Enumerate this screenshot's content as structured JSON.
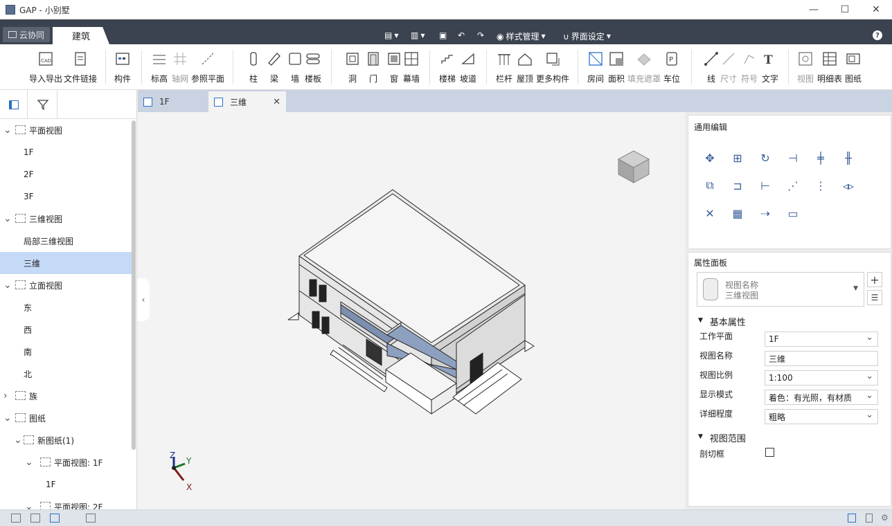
{
  "window": {
    "title": "GAP - 小别墅"
  },
  "tabs": {
    "cloud": "云协同",
    "architecture": "建筑"
  },
  "quick_access": {
    "style_manage": "样式管理",
    "ui_settings": "界面设定"
  },
  "ribbon": {
    "import_export": "导入导出",
    "file_link": "文件链接",
    "component": "构件",
    "elevation": "标高",
    "axis_grid": "轴网",
    "ref_plane": "参照平面",
    "column": "柱",
    "beam": "梁",
    "wall": "墙",
    "floor": "楼板",
    "opening": "洞",
    "door": "门",
    "window": "窗",
    "curtain_wall": "幕墙",
    "stair": "楼梯",
    "ramp": "坡道",
    "railing": "栏杆",
    "roof": "屋顶",
    "more": "更多构件",
    "room": "房间",
    "area": "面积",
    "fill_mask": "填充遮罩",
    "parking": "车位",
    "line": "线",
    "dimension": "尺寸",
    "symbol": "符号",
    "text": "文字",
    "view": "视图",
    "schedule": "明细表",
    "sheet": "图纸",
    "cad_badge": "CAD"
  },
  "tree": [
    {
      "label": "平面视图",
      "level": 0,
      "expanded": true
    },
    {
      "label": "1F",
      "level": 1
    },
    {
      "label": "2F",
      "level": 1
    },
    {
      "label": "3F",
      "level": 1
    },
    {
      "label": "三维视图",
      "level": 0,
      "expanded": true
    },
    {
      "label": "局部三维视图",
      "level": 1
    },
    {
      "label": "三维",
      "level": 1,
      "selected": true
    },
    {
      "label": "立面视图",
      "level": 0,
      "expanded": true
    },
    {
      "label": "东",
      "level": 1
    },
    {
      "label": "西",
      "level": 1
    },
    {
      "label": "南",
      "level": 1
    },
    {
      "label": "北",
      "level": 1
    },
    {
      "label": "族",
      "level": 0,
      "expanded": false
    },
    {
      "label": "图纸",
      "level": 0,
      "expanded": true
    },
    {
      "label": "新图纸(1)",
      "level": 1,
      "expanded": true
    },
    {
      "label": "平面视图: 1F",
      "level": 2,
      "expanded": true
    },
    {
      "label": "1F",
      "level": 3
    },
    {
      "label": "平面视图: 2F",
      "level": 2,
      "expanded": true
    }
  ],
  "doc_tabs": [
    {
      "label": "1F"
    },
    {
      "label": "三维",
      "active": true
    }
  ],
  "axes": {
    "z": "Z",
    "y": "Y",
    "x": "X"
  },
  "general_edit": {
    "title": "通用编辑"
  },
  "properties": {
    "title": "属性面板",
    "type_line1": "视图名称",
    "type_line2": "三维视图",
    "section_basic": "基本属性",
    "rows": [
      {
        "label": "工作平面",
        "value": "1F",
        "dropdown": true
      },
      {
        "label": "视图名称",
        "value": "三维",
        "dropdown": false
      },
      {
        "label": "视图比例",
        "value": "1:100",
        "dropdown": true
      },
      {
        "label": "显示模式",
        "value": "着色：有光照，有材质",
        "dropdown": true
      },
      {
        "label": "详细程度",
        "value": "粗略",
        "dropdown": true
      }
    ],
    "section_range": "视图范围",
    "section_box": "剖切框",
    "section_box_checked": false
  },
  "colors": {
    "accent": "#c5daf6",
    "tabbar": "#3c4350",
    "doctabs": "#c9d3e1"
  }
}
